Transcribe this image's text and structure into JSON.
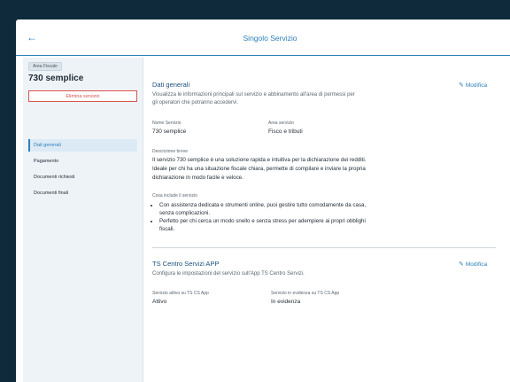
{
  "header": {
    "back_icon": "arrow-left-icon",
    "title": "Singolo Servizio"
  },
  "sidebar": {
    "badge": "Area Fiscale",
    "service_title": "730 semplice",
    "delete_label": "Elimina servizio",
    "items": [
      {
        "label": "Dati generali",
        "active": true
      },
      {
        "label": "Pagamento",
        "active": false
      },
      {
        "label": "Documenti richiesti",
        "active": false
      },
      {
        "label": "Documenti finali",
        "active": false
      }
    ]
  },
  "general": {
    "title": "Dati generali",
    "edit_label": "Modifica",
    "subtitle_line1": "Visualizza le informazioni principali sul servizio e abbinamento all'area di permessi per",
    "subtitle_line2": "gli operatori che potranno accedervi.",
    "name_label": "Nome Servizio",
    "name_value": "730 semplice",
    "area_label": "Area servizio",
    "area_value": "Fisco e tributi",
    "desc_label": "Descrizione breve",
    "desc_line1": "Il servizio 730 semplice è una soluzione rapida e intuitiva per la dichiarazione dei redditi.",
    "desc_line2": "Ideale per chi ha una situazione fiscale chiara, permette di compilare e inviare la propria",
    "desc_line3": "dichiarazione in modo facile e veloce.",
    "includes_label": "Cosa include il servizio",
    "bullet1_line1": "Con assistenza dedicata e strumenti online, puoi gestire tutto comodamente da casa,",
    "bullet1_line2": "senza complicazioni.",
    "bullet2_line1": "Perfetto per chi cerca un modo snello e senza stress per adempiere ai propri obblighi",
    "bullet2_line2": "fiscali."
  },
  "app": {
    "title": "TS Centro Servizi APP",
    "edit_label": "Modifica",
    "subtitle": "Configura le impostazioni del servizio sull'App TS Centro Servizi.",
    "active_label": "Servizio attivo su TS CS App",
    "active_value": "Attivo",
    "featured_label": "Servizio in evidenza su TS CS App",
    "featured_value": "In evidenza"
  },
  "colors": {
    "accent": "#2b7fb8",
    "danger": "#d9534f",
    "background": "#0f2a3a"
  }
}
